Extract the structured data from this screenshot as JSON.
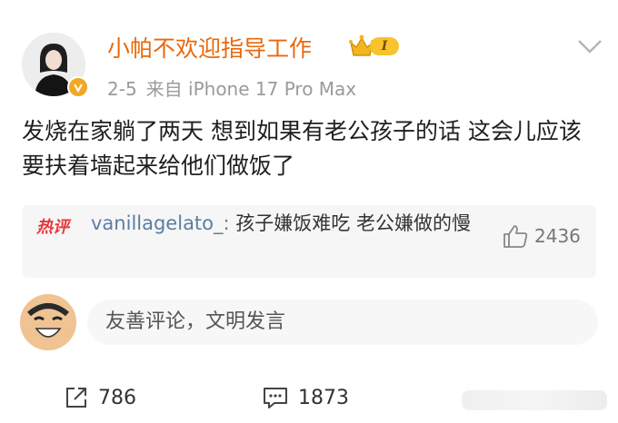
{
  "post": {
    "username": "小帕不欢迎指导工作",
    "rank_level": "I",
    "date": "2-5",
    "source": "来自 iPhone 17 Pro Max",
    "content": "发烧在家躺了两天 想到如果有老公孩子的话 这会儿应该要扶着墙起来给他们做饭了"
  },
  "hot_comment": {
    "tag": "热评",
    "user": "vanillagelato_:",
    "text": " 孩子嫌饭难吃 老公嫌做的慢",
    "likes": "2436"
  },
  "comment_box": {
    "placeholder": "友善评论，文明发言"
  },
  "actions": {
    "reposts": "786",
    "comments": "1873"
  },
  "colors": {
    "username": "#e8690c",
    "hot_tag": "#e4393c",
    "verified_badge": "#f5a623"
  }
}
